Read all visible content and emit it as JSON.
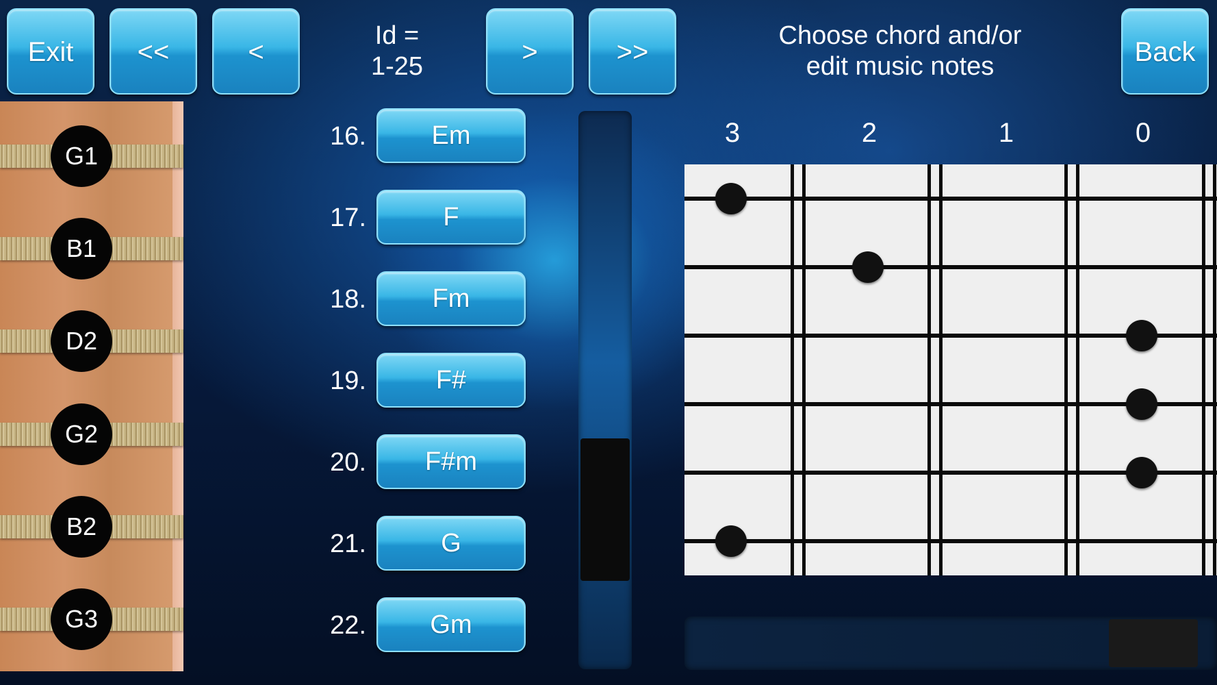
{
  "toolbar": {
    "exit": "Exit",
    "first": "<<",
    "prev": "<",
    "id_label_line1": "Id =",
    "id_label_line2": "1-25",
    "next": ">",
    "last": ">>",
    "heading_line1": "Choose chord and/or",
    "heading_line2": "edit music notes",
    "back": "Back"
  },
  "strings": [
    "G1",
    "B1",
    "D2",
    "G2",
    "B2",
    "G3"
  ],
  "chords": [
    {
      "num": "16.",
      "name": "Em"
    },
    {
      "num": "17.",
      "name": "F"
    },
    {
      "num": "18.",
      "name": "Fm"
    },
    {
      "num": "19.",
      "name": "F#"
    },
    {
      "num": "20.",
      "name": "F#m"
    },
    {
      "num": "21.",
      "name": "G"
    },
    {
      "num": "22.",
      "name": "Gm"
    }
  ],
  "fretboard": {
    "fret_labels": [
      "3",
      "2",
      "1",
      "0"
    ],
    "dots": [
      {
        "string": 1,
        "fret": "3"
      },
      {
        "string": 2,
        "fret": "2"
      },
      {
        "string": 3,
        "fret": "0"
      },
      {
        "string": 4,
        "fret": "0"
      },
      {
        "string": 5,
        "fret": "0"
      },
      {
        "string": 6,
        "fret": "3"
      }
    ]
  }
}
